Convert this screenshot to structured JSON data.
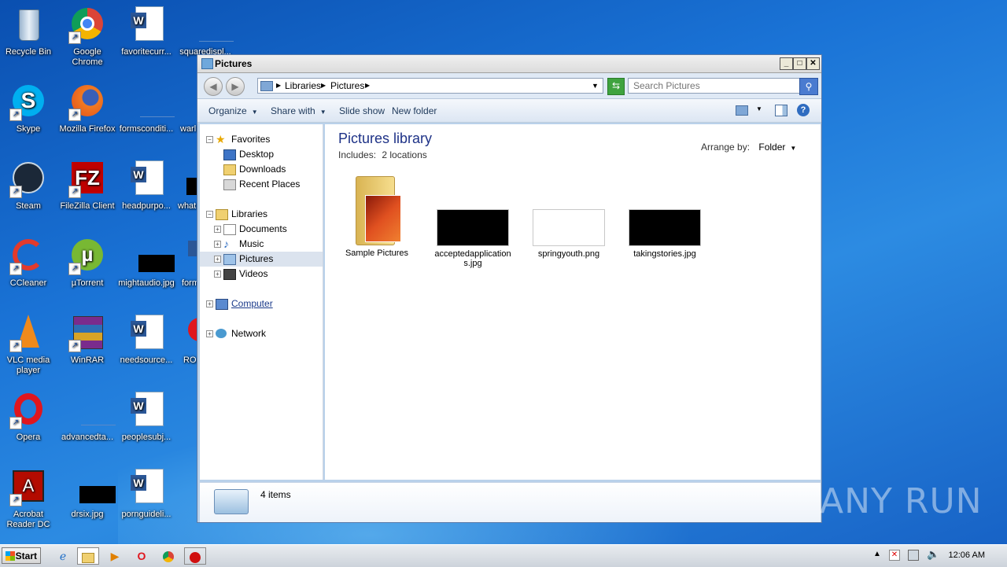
{
  "desktop": {
    "icons": [
      {
        "label": "Recycle Bin"
      },
      {
        "label": "Google Chrome"
      },
      {
        "label": "favoritecurr..."
      },
      {
        "label": "squaredispl..."
      },
      {
        "label": "Skype"
      },
      {
        "label": "Mozilla Firefox"
      },
      {
        "label": "formsconditi..."
      },
      {
        "label": "warl..."
      },
      {
        "label": "Steam"
      },
      {
        "label": "FileZilla Client"
      },
      {
        "label": "headpurpo..."
      },
      {
        "label": "what..."
      },
      {
        "label": "CCleaner"
      },
      {
        "label": "µTorrent"
      },
      {
        "label": "mightaudio.jpg"
      },
      {
        "label": "form..."
      },
      {
        "label": "VLC media player"
      },
      {
        "label": "WinRAR"
      },
      {
        "label": "needsource..."
      },
      {
        "label": "RO..."
      },
      {
        "label": "Opera"
      },
      {
        "label": "advancedta..."
      },
      {
        "label": "peoplesubj..."
      },
      {
        "label": "Acrobat Reader DC"
      },
      {
        "label": "drsix.jpg"
      },
      {
        "label": "pornguideli..."
      }
    ]
  },
  "window": {
    "title": "Pictures",
    "address": {
      "crumbs": [
        "Libraries",
        "Pictures"
      ]
    },
    "search": {
      "placeholder": "Search Pictures"
    },
    "commands": {
      "organize": "Organize",
      "share_with": "Share with",
      "slide_show": "Slide show",
      "new_folder": "New folder"
    },
    "nav": {
      "favorites": "Favorites",
      "desktop": "Desktop",
      "downloads": "Downloads",
      "recent_places": "Recent Places",
      "libraries": "Libraries",
      "documents": "Documents",
      "music": "Music",
      "pictures": "Pictures",
      "videos": "Videos",
      "computer": "Computer",
      "network": "Network"
    },
    "content": {
      "title": "Pictures library",
      "includes_label": "Includes:",
      "includes_link": "2 locations",
      "arrange_label": "Arrange by:",
      "arrange_value": "Folder",
      "items": [
        {
          "name": "Sample Pictures"
        },
        {
          "name": "acceptedapplications.jpg"
        },
        {
          "name": "springyouth.png"
        },
        {
          "name": "takingstories.jpg"
        }
      ]
    },
    "status": {
      "count": "4 items"
    }
  },
  "taskbar": {
    "start": "Start",
    "clock": "12:06 AM"
  },
  "watermark": "ANY RUN"
}
